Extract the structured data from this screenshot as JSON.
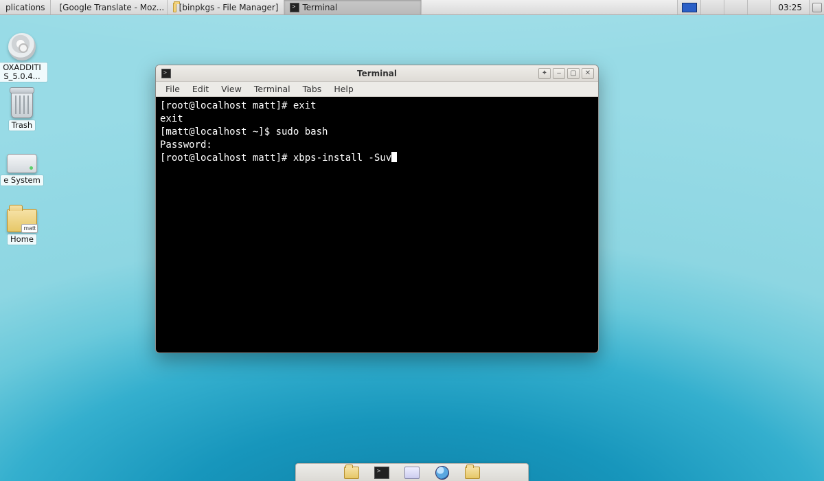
{
  "panel": {
    "applications_label": "plications",
    "tasks": [
      {
        "label": "[Google Translate - Moz...",
        "icon": "globe",
        "active": false
      },
      {
        "label": "[binpkgs - File Manager]",
        "icon": "folder",
        "active": false
      },
      {
        "label": "Terminal",
        "icon": "term",
        "active": true
      }
    ],
    "clock": "03:25"
  },
  "desktop_icons": {
    "disc_label": "OXADDITI\nS_5.0.4...",
    "trash_label": "Trash",
    "filesystem_label": "e System",
    "home_label": "Home",
    "home_tag": "matt"
  },
  "terminal": {
    "title": "Terminal",
    "menu": {
      "file": "File",
      "edit": "Edit",
      "view": "View",
      "terminal": "Terminal",
      "tabs": "Tabs",
      "help": "Help"
    },
    "window_buttons": {
      "stick": "✦",
      "min": "–",
      "max": "▢",
      "close": "✕"
    },
    "lines": {
      "l1": "[root@localhost matt]# exit",
      "l2": "exit",
      "l3": "[matt@localhost ~]$ sudo bash",
      "l4": "Password:",
      "l5": "[root@localhost matt]# xbps-install -Suv"
    }
  }
}
